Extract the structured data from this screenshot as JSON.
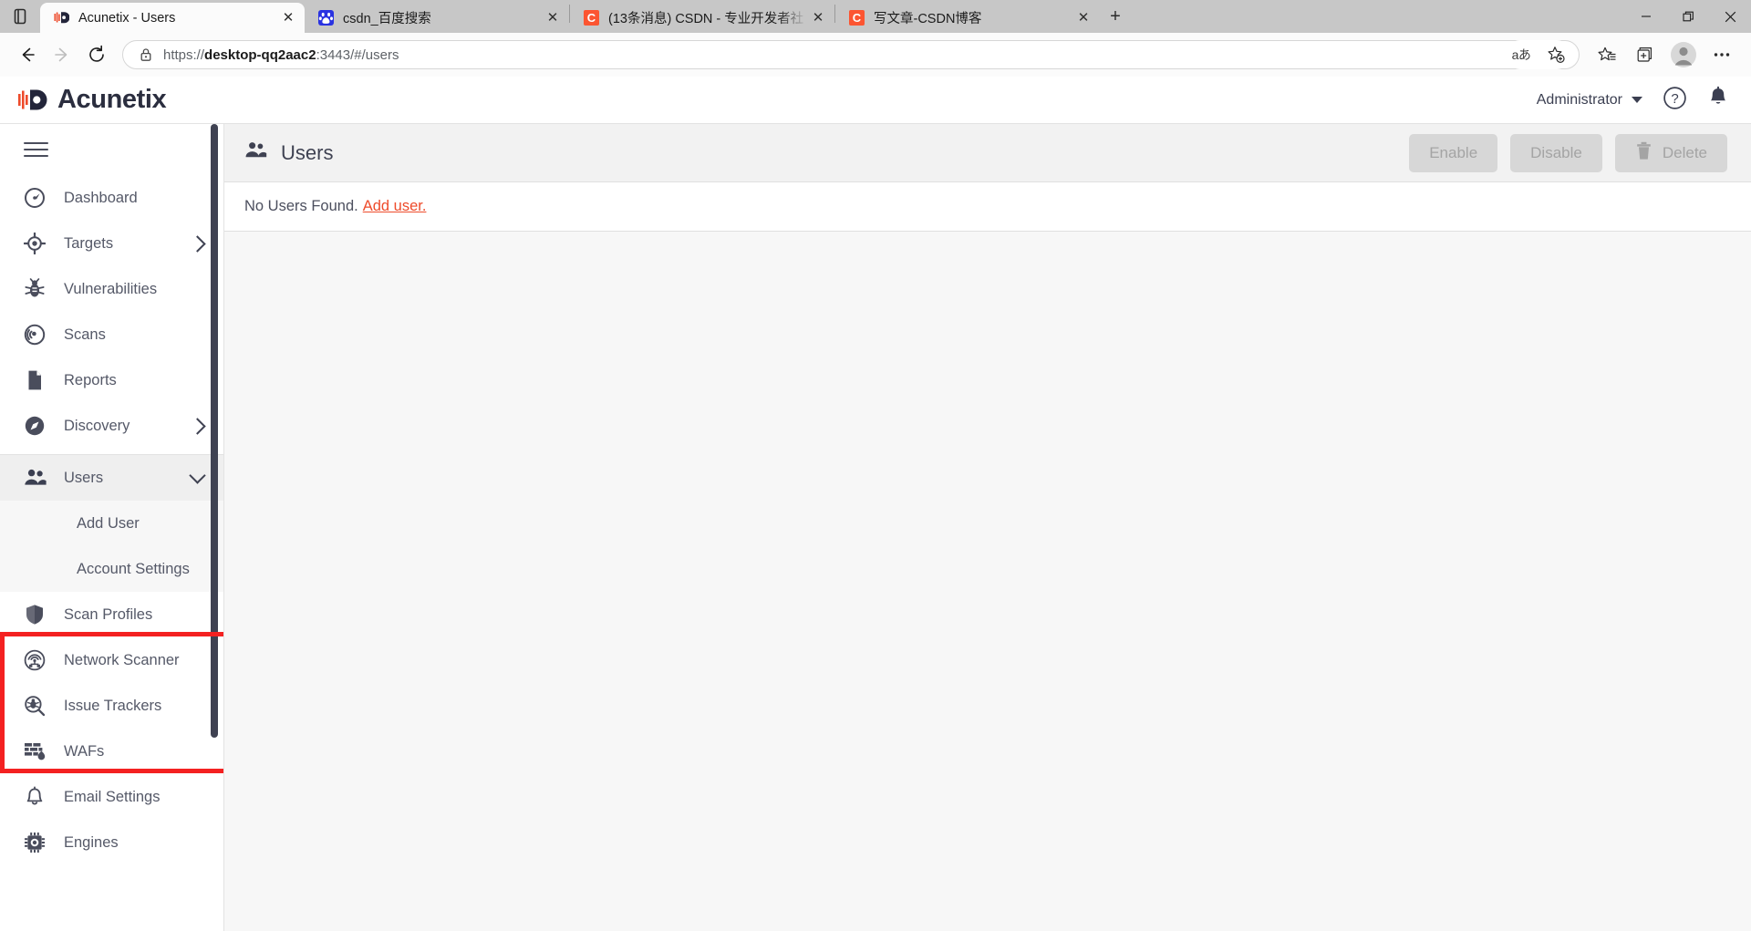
{
  "browser": {
    "tab_search_icon": "tab-search-icon",
    "tabs": [
      {
        "title": "Acunetix - Users",
        "favicon": "acunetix-favicon",
        "active": true
      },
      {
        "title": "csdn_百度搜索",
        "favicon": "baidu-favicon",
        "active": false
      },
      {
        "title": "(13条消息) CSDN - 专业开发者社",
        "favicon": "csdn-favicon",
        "active": false
      },
      {
        "title": "写文章-CSDN博客",
        "favicon": "csdn-favicon",
        "active": false
      }
    ],
    "new_tab_label": "+",
    "window_controls": {
      "minimize": "—",
      "restore": "❐",
      "close": "✕"
    },
    "nav": {
      "back": "back-arrow-icon",
      "forward": "forward-arrow-icon",
      "reload": "reload-icon"
    },
    "address": {
      "lock_icon": "lock-icon",
      "scheme": "https://",
      "host": "desktop-qq2aac2",
      "rest": ":3443/#/users",
      "full": "https://desktop-qq2aac2:3443/#/users"
    },
    "toolbar_icons": [
      "read-aloud-icon",
      "add-favorite-icon",
      "favorites-icon",
      "collections-icon",
      "profile-avatar-icon",
      "settings-more-icon"
    ],
    "read_aloud_glyph": "aあ"
  },
  "app": {
    "brand": {
      "name": "Acunetix",
      "logo_icon": "acunetix-logo-icon"
    },
    "header": {
      "user_label": "Administrator",
      "user_caret_icon": "chevron-down-icon",
      "help_icon": "help-circle-icon",
      "notifications_icon": "bell-icon"
    },
    "sidebar": {
      "menu_toggle_icon": "hamburger-icon",
      "items": [
        {
          "label": "Dashboard",
          "icon": "dashboard-gauge-icon",
          "expandable": false
        },
        {
          "label": "Targets",
          "icon": "target-crosshair-icon",
          "expandable": true
        },
        {
          "label": "Vulnerabilities",
          "icon": "bug-icon",
          "expandable": false
        },
        {
          "label": "Scans",
          "icon": "radar-scan-icon",
          "expandable": false
        },
        {
          "label": "Reports",
          "icon": "document-icon",
          "expandable": false
        },
        {
          "label": "Discovery",
          "icon": "compass-icon",
          "expandable": true
        }
      ],
      "users_group": {
        "label": "Users",
        "icon": "users-icon",
        "expanded": true,
        "chevron_icon": "chevron-down-icon",
        "children": [
          {
            "label": "Add User"
          },
          {
            "label": "Account Settings"
          }
        ],
        "highlight_color": "#f42121"
      },
      "items_after": [
        {
          "label": "Scan Profiles",
          "icon": "shield-icon"
        },
        {
          "label": "Network Scanner",
          "icon": "network-scanner-icon"
        },
        {
          "label": "Issue Trackers",
          "icon": "issue-tracker-icon"
        },
        {
          "label": "WAFs",
          "icon": "firewall-icon"
        },
        {
          "label": "Email Settings",
          "icon": "bell-icon"
        },
        {
          "label": "Engines",
          "icon": "chip-icon"
        }
      ]
    },
    "page": {
      "title": "Users",
      "title_icon": "users-icon",
      "actions": [
        {
          "label": "Enable",
          "disabled": true,
          "icon": null
        },
        {
          "label": "Disable",
          "disabled": true,
          "icon": null
        },
        {
          "label": "Delete",
          "disabled": true,
          "icon": "trash-icon"
        }
      ],
      "empty_state": {
        "message": "No Users Found.",
        "link_label": "Add user.",
        "link_color": "#ee4b2b"
      }
    }
  }
}
